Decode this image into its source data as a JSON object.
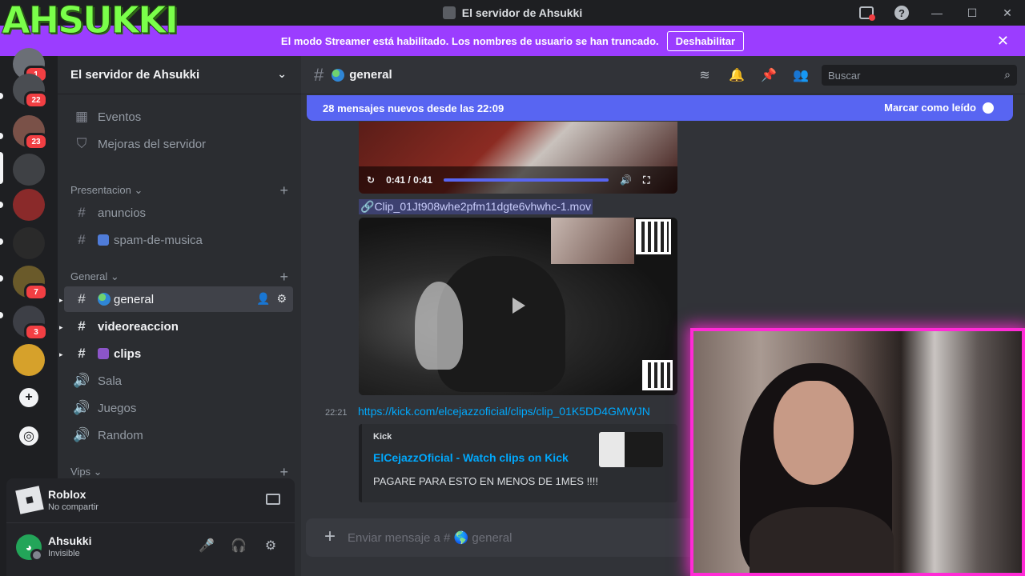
{
  "window": {
    "title": "El servidor de Ahsukki",
    "minimize": "—",
    "maximize": "☐",
    "close": "✕",
    "help": "?"
  },
  "overlay": {
    "logo_text": "AHSUKKI"
  },
  "banner": {
    "text": "El modo Streamer está habilitado. Los nombres de usuario se han truncado.",
    "button": "Deshabilitar",
    "close": "✕"
  },
  "servers": [
    {
      "badge": "1",
      "color": "#6b6f76"
    },
    {
      "badge": "22",
      "color": "#4a4d52"
    },
    {
      "badge": "23",
      "color": "#7a5148"
    },
    {
      "badge": "",
      "color": "#3f4145"
    },
    {
      "badge": "",
      "color": "#8a2a2a"
    },
    {
      "badge": "",
      "color": "#2a2a2a"
    },
    {
      "badge": "7",
      "color": "#6a5a2a"
    },
    {
      "badge": "3",
      "color": "#3d3f46"
    },
    {
      "badge": "",
      "color": "#d6a12b"
    }
  ],
  "rail_actions": {
    "add": "+",
    "discover": "◎"
  },
  "sidebar": {
    "server_name": "El servidor de Ahsukki",
    "chevron": "⌄",
    "top_items": [
      {
        "icon": "▦",
        "label": "Eventos"
      },
      {
        "icon": "⛉",
        "label": "Mejoras del servidor"
      }
    ],
    "categories": {
      "presentacion": "Presentacion ⌄",
      "general": "General ⌄",
      "vips": "Vips ⌄",
      "plus": "+"
    },
    "channels": {
      "anuncios": "anuncios",
      "spam": "spam-de-musica",
      "general": "general",
      "videoreaccion": "videoreaccion",
      "clips": "clips",
      "sala": "Sala",
      "juegos": "Juegos",
      "random": "Random"
    },
    "icons": {
      "hash": "#",
      "voice": "🔊",
      "invite": "👤",
      "settings": "⚙"
    }
  },
  "activity": {
    "title": "Roblox",
    "subtitle": "No compartir"
  },
  "user": {
    "name": "Ahsukki",
    "status": "Invisible",
    "mic": "🎤",
    "headphones": "🎧",
    "settings": "⚙"
  },
  "chat": {
    "hash": "#",
    "channel": "general",
    "header_icons": {
      "threads": "≋",
      "bell": "🔔",
      "pin": "📌",
      "members": "👥"
    },
    "search_placeholder": "Buscar",
    "search_icon": "⌕",
    "new_messages": "28 mensajes nuevos desde las 22:09",
    "mark_read": "Marcar como leído",
    "video": {
      "replay": "↻",
      "time": "0:41 / 0:41",
      "progress": 1.0,
      "volume": "🔊",
      "fullscreen": "⛶"
    },
    "attachment_name": "Clip_01Jt908whe2pfm11dgte6vhwhc-1.mov",
    "message": {
      "time": "22:21",
      "link": "https://kick.com/elcejazzoficial/clips/clip_01K5DD4GMWJN",
      "embed_provider": "Kick",
      "embed_title": "ElCejazzOficial - Watch clips on Kick",
      "embed_desc": "PAGARE PARA ESTO EN MENOS DE 1MES !!!!"
    },
    "composer_placeholder": "Enviar mensaje a # 🌎 general",
    "composer_add": "+"
  }
}
